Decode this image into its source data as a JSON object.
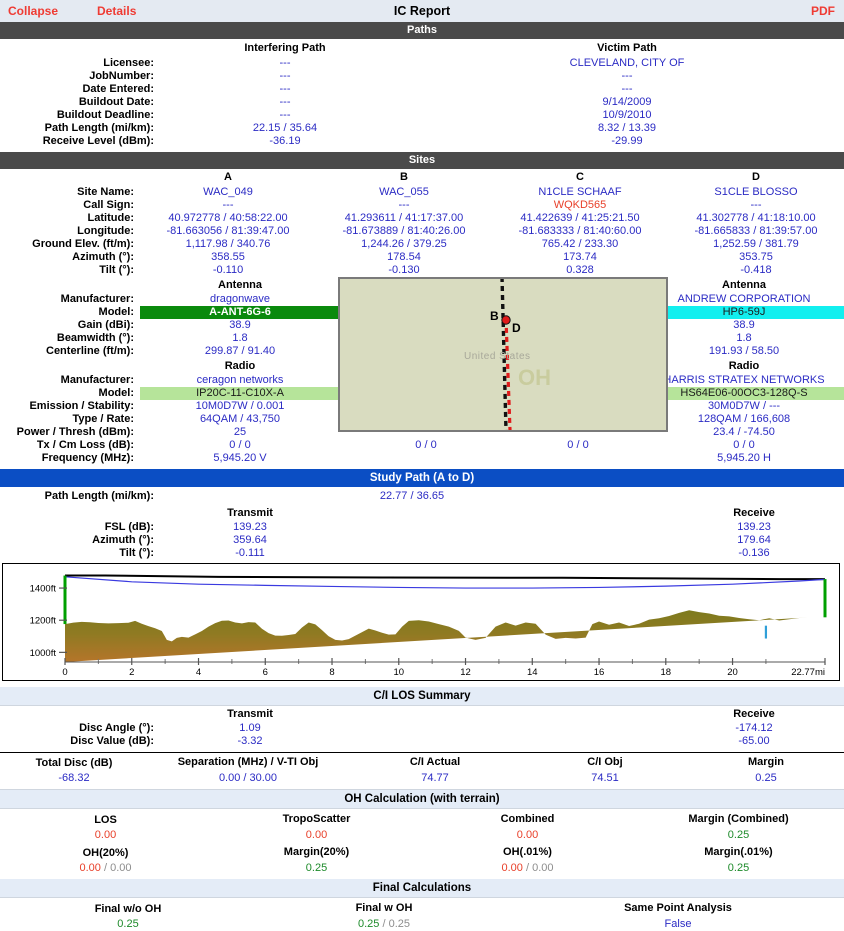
{
  "toolbar": {
    "collapse": "Collapse",
    "details": "Details",
    "title": "IC Report",
    "pdf": "PDF"
  },
  "paths": {
    "band": "Paths",
    "col_interfering": "Interfering Path",
    "col_victim": "Victim Path",
    "rows": [
      {
        "label": "Licensee:",
        "interfering": "---",
        "victim": "CLEVELAND, CITY OF"
      },
      {
        "label": "JobNumber:",
        "interfering": "---",
        "victim": "---"
      },
      {
        "label": "Date Entered:",
        "interfering": "---",
        "victim": "---"
      },
      {
        "label": "Buildout Date:",
        "interfering": "---",
        "victim": "9/14/2009"
      },
      {
        "label": "Buildout Deadline:",
        "interfering": "---",
        "victim": "10/9/2010"
      },
      {
        "label": "Path Length (mi/km):",
        "interfering": "22.15 / 35.64",
        "victim": "8.32 / 13.39"
      },
      {
        "label": "Receive Level (dBm):",
        "interfering": "-36.19",
        "victim": "-29.99"
      }
    ]
  },
  "sites": {
    "band": "Sites",
    "columns": [
      "A",
      "B",
      "C",
      "D"
    ],
    "rows": [
      {
        "label": "Site Name:",
        "values": [
          "WAC_049",
          "WAC_055",
          "N1CLE SCHAAF",
          "S1CLE BLOSSO"
        ]
      },
      {
        "label": "Call Sign:",
        "values": [
          "---",
          "---",
          "WQKD565",
          "---"
        ],
        "styles": [
          "val",
          "val",
          "red",
          "val"
        ]
      },
      {
        "label": "Latitude:",
        "values": [
          "40.972778 / 40:58:22.00",
          "41.293611 / 41:17:37.00",
          "41.422639 / 41:25:21.50",
          "41.302778 / 41:18:10.00"
        ]
      },
      {
        "label": "Longitude:",
        "values": [
          "-81.663056 / 81:39:47.00",
          "-81.673889 / 81:40:26.00",
          "-81.683333 / 81:40:60.00",
          "-81.665833 / 81:39:57.00"
        ]
      },
      {
        "label": "Ground Elev. (ft/m):",
        "values": [
          "1,117.98 / 340.76",
          "1,244.26 / 379.25",
          "765.42 / 233.30",
          "1,252.59 / 381.79"
        ]
      },
      {
        "label": "Azimuth (°):",
        "values": [
          "358.55",
          "178.54",
          "173.74",
          "353.75"
        ]
      },
      {
        "label": "Tilt (°):",
        "values": [
          "-0.110",
          "-0.130",
          "0.328",
          "-0.418"
        ]
      }
    ]
  },
  "antenna": {
    "heading": "Antenna",
    "manufacturer_label": "Manufacturer:",
    "manufacturer_left": "dragonwave",
    "manufacturer_right": "ANDREW CORPORATION",
    "model_label": "Model:",
    "model_left": "A-ANT-6G-6",
    "model_right": "HP6-59J",
    "rows": [
      {
        "label": "Gain (dBi):",
        "left": "38.9",
        "right": "38.9"
      },
      {
        "label": "Beamwidth (°):",
        "left": "1.8",
        "right": "1.8"
      },
      {
        "label": "Centerline (ft/m):",
        "left": "299.87 / 91.40",
        "right": "191.93 / 58.50"
      }
    ]
  },
  "radio": {
    "heading": "Radio",
    "manufacturer_label": "Manufacturer:",
    "manufacturer_left": "ceragon networks",
    "manufacturer_right": "HARRIS STRATEX NETWORKS",
    "model_label": "Model:",
    "model_left": "IP20C-11-C10X-A",
    "model_right": "HS64E06-00OC3-128Q-S",
    "rows": [
      {
        "label": "Emission / Stability:",
        "left": "10M0D7W / 0.001",
        "right": "30M0D7W / ---"
      },
      {
        "label": "Type / Rate:",
        "left": "64QAM / 43,750",
        "right": "128QAM / 166,608"
      },
      {
        "label": "Power / Thresh (dBm):",
        "left": "25",
        "right": "23.4 / -74.50"
      }
    ],
    "tx_cm_label": "Tx / Cm Loss (dB):",
    "tx_cm": [
      "0 / 0",
      "0 / 0",
      "0 / 0",
      "0 / 0"
    ],
    "freq_label": "Frequency (MHz):",
    "freq_left": "5,945.20 V",
    "freq_right": "5,945.20 H"
  },
  "map": {
    "country_label": "United States",
    "state_label": "OH",
    "marker_b": "B",
    "marker_d": "D"
  },
  "study_path": {
    "band": "Study Path (A to D)",
    "path_length_label": "Path Length (mi/km):",
    "path_length_value": "22.77 / 36.65",
    "col_transmit": "Transmit",
    "col_receive": "Receive",
    "rows": [
      {
        "label": "FSL (dB):",
        "transmit": "139.23",
        "receive": "139.23"
      },
      {
        "label": "Azimuth (°):",
        "transmit": "359.64",
        "receive": "179.64"
      },
      {
        "label": "Tilt (°):",
        "transmit": "-0.111",
        "receive": "-0.136"
      }
    ]
  },
  "chart_data": {
    "type": "area",
    "title": "",
    "xlabel": "",
    "ylabel": "",
    "xlim": [
      0,
      22.77
    ],
    "ylim": [
      940,
      1500
    ],
    "ytick_labels": [
      "1000ft",
      "1200ft",
      "1400ft"
    ],
    "yticks": [
      1000,
      1200,
      1400
    ],
    "xtick_labels": [
      "0",
      "2",
      "4",
      "6",
      "8",
      "10",
      "12",
      "14",
      "16",
      "18",
      "20",
      "22.77mi"
    ],
    "xticks": [
      0,
      2,
      4,
      6,
      8,
      10,
      12,
      14,
      16,
      18,
      20,
      22.77
    ],
    "grid": false,
    "legend": "none",
    "series": [
      {
        "name": "terrain",
        "color": "#8b7a26",
        "x": [
          0,
          0.25,
          0.5,
          0.75,
          1,
          1.3,
          1.6,
          1.9,
          2.1,
          2.3,
          2.5,
          2.7,
          2.9,
          3.05,
          3.2,
          3.35,
          3.5,
          3.7,
          3.9,
          4.1,
          4.3,
          4.5,
          4.7,
          4.9,
          5.1,
          5.3,
          5.5,
          5.7,
          5.9,
          6.1,
          6.3,
          6.5,
          6.7,
          6.9,
          7.1,
          7.3,
          7.5,
          7.7,
          7.9,
          8.1,
          8.3,
          8.5,
          8.7,
          8.9,
          9.1,
          9.3,
          9.5,
          9.7,
          9.9,
          10.1,
          10.3,
          10.6,
          10.9,
          11.2,
          11.5,
          11.8,
          12,
          12.3,
          12.6,
          12.9,
          13.2,
          13.5,
          13.8,
          14.1,
          14.4,
          14.7,
          15,
          15.3,
          15.6,
          15.8,
          16,
          16.3,
          16.6,
          16.9,
          17.2,
          17.5,
          17.8,
          18.1,
          18.4,
          18.7,
          19,
          19.3,
          19.6,
          19.9,
          20.2,
          20.5,
          20.8,
          21.1,
          21.4,
          21.7,
          22,
          22.3,
          22.6,
          22.77
        ],
        "y": [
          1176,
          1185,
          1190,
          1187,
          1183,
          1180,
          1182,
          1184,
          1196,
          1178,
          1163,
          1150,
          1133,
          1078,
          1068,
          1090,
          1096,
          1092,
          1112,
          1133,
          1160,
          1182,
          1197,
          1198,
          1186,
          1180,
          1188,
          1186,
          1147,
          1120,
          1104,
          1103,
          1108,
          1114,
          1155,
          1186,
          1174,
          1138,
          1100,
          1078,
          1074,
          1082,
          1104,
          1126,
          1148,
          1136,
          1122,
          1110,
          1112,
          1160,
          1196,
          1200,
          1192,
          1176,
          1160,
          1134,
          1092,
          1078,
          1090,
          1160,
          1186,
          1166,
          1186,
          1178,
          1110,
          1084,
          1090,
          1086,
          1092,
          1176,
          1192,
          1172,
          1186,
          1164,
          1178,
          1204,
          1212,
          1226,
          1246,
          1262,
          1250,
          1242,
          1228,
          1224,
          1214,
          1206,
          1200,
          1212,
          1198,
          1206,
          1214,
          1218
        ]
      },
      {
        "name": "line-of-sight",
        "color": "#000000",
        "x": [
          0,
          1.2,
          4.6,
          9.6,
          14.9,
          17.9,
          21.4,
          22.77
        ],
        "y": [
          1478,
          1478,
          1470,
          1466,
          1464,
          1460,
          1456,
          1456
        ]
      },
      {
        "name": "fresnel",
        "color": "#3a3ae0",
        "x": [
          0,
          2,
          4,
          6,
          8,
          10,
          12,
          14,
          16,
          18,
          20,
          22,
          22.77
        ],
        "y": [
          1470,
          1439,
          1424,
          1417,
          1410,
          1404,
          1400,
          1400,
          1404,
          1412,
          1424,
          1444,
          1454
        ]
      }
    ],
    "markers": [
      {
        "name": "tx-tower",
        "x": 0,
        "color": "#00a000",
        "y_bottom": 1176,
        "y_top": 1478
      },
      {
        "name": "rx-tower",
        "x": 22.77,
        "color": "#00a000",
        "y_bottom": 1218,
        "y_top": 1456
      },
      {
        "name": "obstruction",
        "x": 21.0,
        "color": "#2f9fd8",
        "y_bottom": 1086,
        "y_top": 1166
      }
    ]
  },
  "ci_summary": {
    "band": "C/I LOS Summary",
    "col_transmit": "Transmit",
    "col_receive": "Receive",
    "rows": [
      {
        "label": "Disc Angle (°):",
        "transmit": "1.09",
        "receive": "-174.12"
      },
      {
        "label": "Disc Value (dB):",
        "transmit": "-3.32",
        "receive": "-65.00"
      }
    ],
    "totals_headers": [
      "Total Disc (dB)",
      "Separation (MHz) / V-TI Obj",
      "C/I Actual",
      "C/I Obj",
      "Margin"
    ],
    "totals_values": [
      "-68.32",
      "0.00 / 30.00",
      "74.77",
      "74.51",
      "0.25"
    ]
  },
  "oh_calculation": {
    "band": "OH Calculation (with terrain)",
    "row1_headers": [
      "LOS",
      "TropoScatter",
      "Combined",
      "Margin (Combined)"
    ],
    "row1_values": [
      "0.00",
      "0.00",
      "0.00",
      "0.25"
    ],
    "row2_headers": [
      "OH(20%)",
      "Margin(20%)",
      "OH(.01%)",
      "Margin(.01%)"
    ],
    "row2_values_a": [
      "0.00",
      "0.25",
      "0.00",
      "0.25"
    ],
    "row2_values_b": [
      "0.00",
      "",
      "0.00",
      ""
    ]
  },
  "final_calculations": {
    "band": "Final Calculations",
    "headers": [
      "Final w/o OH",
      "Final w OH",
      "Same Point Analysis"
    ],
    "values": [
      "0.25",
      "0.25",
      "False"
    ],
    "final_w_oh_second": "0.25"
  }
}
